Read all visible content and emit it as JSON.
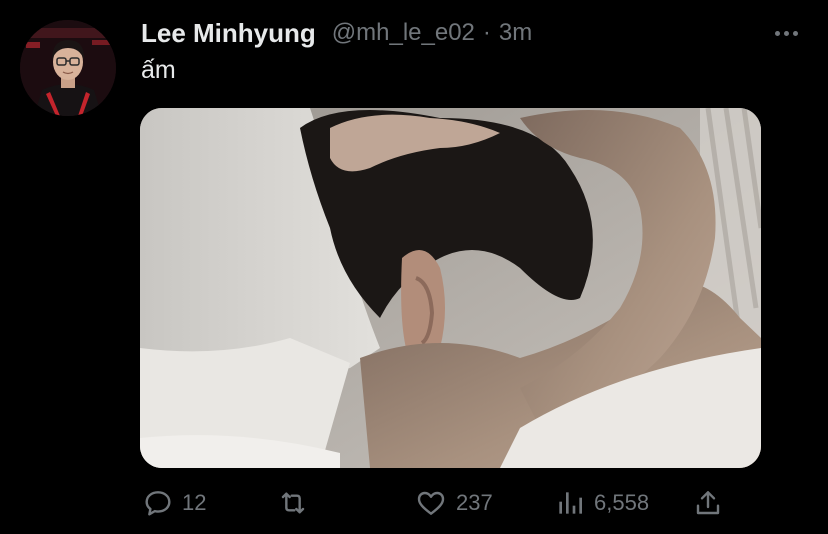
{
  "tweet": {
    "author": {
      "name": "Lee Minhyung",
      "handle": "@mh_le_e02",
      "avatar_icon": "profile-photo"
    },
    "separator": "·",
    "time": "3m",
    "text": "ấm",
    "more_icon": "more-horizontal-icon",
    "media": {
      "description_icon": "photo",
      "colors": {
        "pillow": "#d9d6d0",
        "skin": "#a58f7f",
        "hair": "#1b1715"
      }
    },
    "actions": {
      "reply": {
        "icon": "reply-icon",
        "count": "12"
      },
      "retweet": {
        "icon": "retweet-icon"
      },
      "like": {
        "icon": "heart-icon",
        "count": "237"
      },
      "views": {
        "icon": "analytics-icon",
        "count": "6,558"
      },
      "share": {
        "icon": "share-icon"
      }
    }
  },
  "colors": {
    "background": "#000000",
    "text": "#e7e9ea",
    "muted": "#71767b"
  }
}
